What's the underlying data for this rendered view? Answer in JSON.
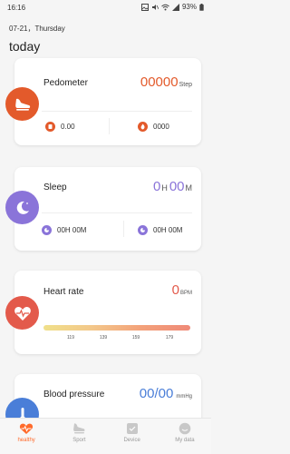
{
  "status_bar": {
    "time": "16:16",
    "battery": "93%"
  },
  "header": {
    "date": "07-21，Thursday",
    "title": "today"
  },
  "pedometer": {
    "title": "Pedometer",
    "value": "00000",
    "unit": "Step",
    "distance": "0.00",
    "calories": "0000",
    "accent": "#e35a2b"
  },
  "sleep": {
    "title": "Sleep",
    "hours": "0",
    "hour_unit": "H",
    "minutes": "00",
    "minute_unit": "M",
    "deep_sleep": "00H 00M",
    "light_sleep": "00H 00M",
    "accent": "#8a74d9"
  },
  "heart_rate": {
    "title": "Heart rate",
    "value": "0",
    "unit": "BPM",
    "ticks": [
      "119",
      "139",
      "159",
      "179"
    ],
    "accent": "#e35a4b"
  },
  "blood_pressure": {
    "title": "Blood pressure",
    "value": "00/00",
    "unit": "mmHg",
    "accent": "#4a7ed8"
  },
  "tabs": [
    {
      "label": "healthy",
      "icon": "heart-pulse-icon",
      "active": true
    },
    {
      "label": "Sport",
      "icon": "shoe-icon",
      "active": false
    },
    {
      "label": "Device",
      "icon": "watch-icon",
      "active": false
    },
    {
      "label": "My data",
      "icon": "smiley-icon",
      "active": false
    }
  ]
}
